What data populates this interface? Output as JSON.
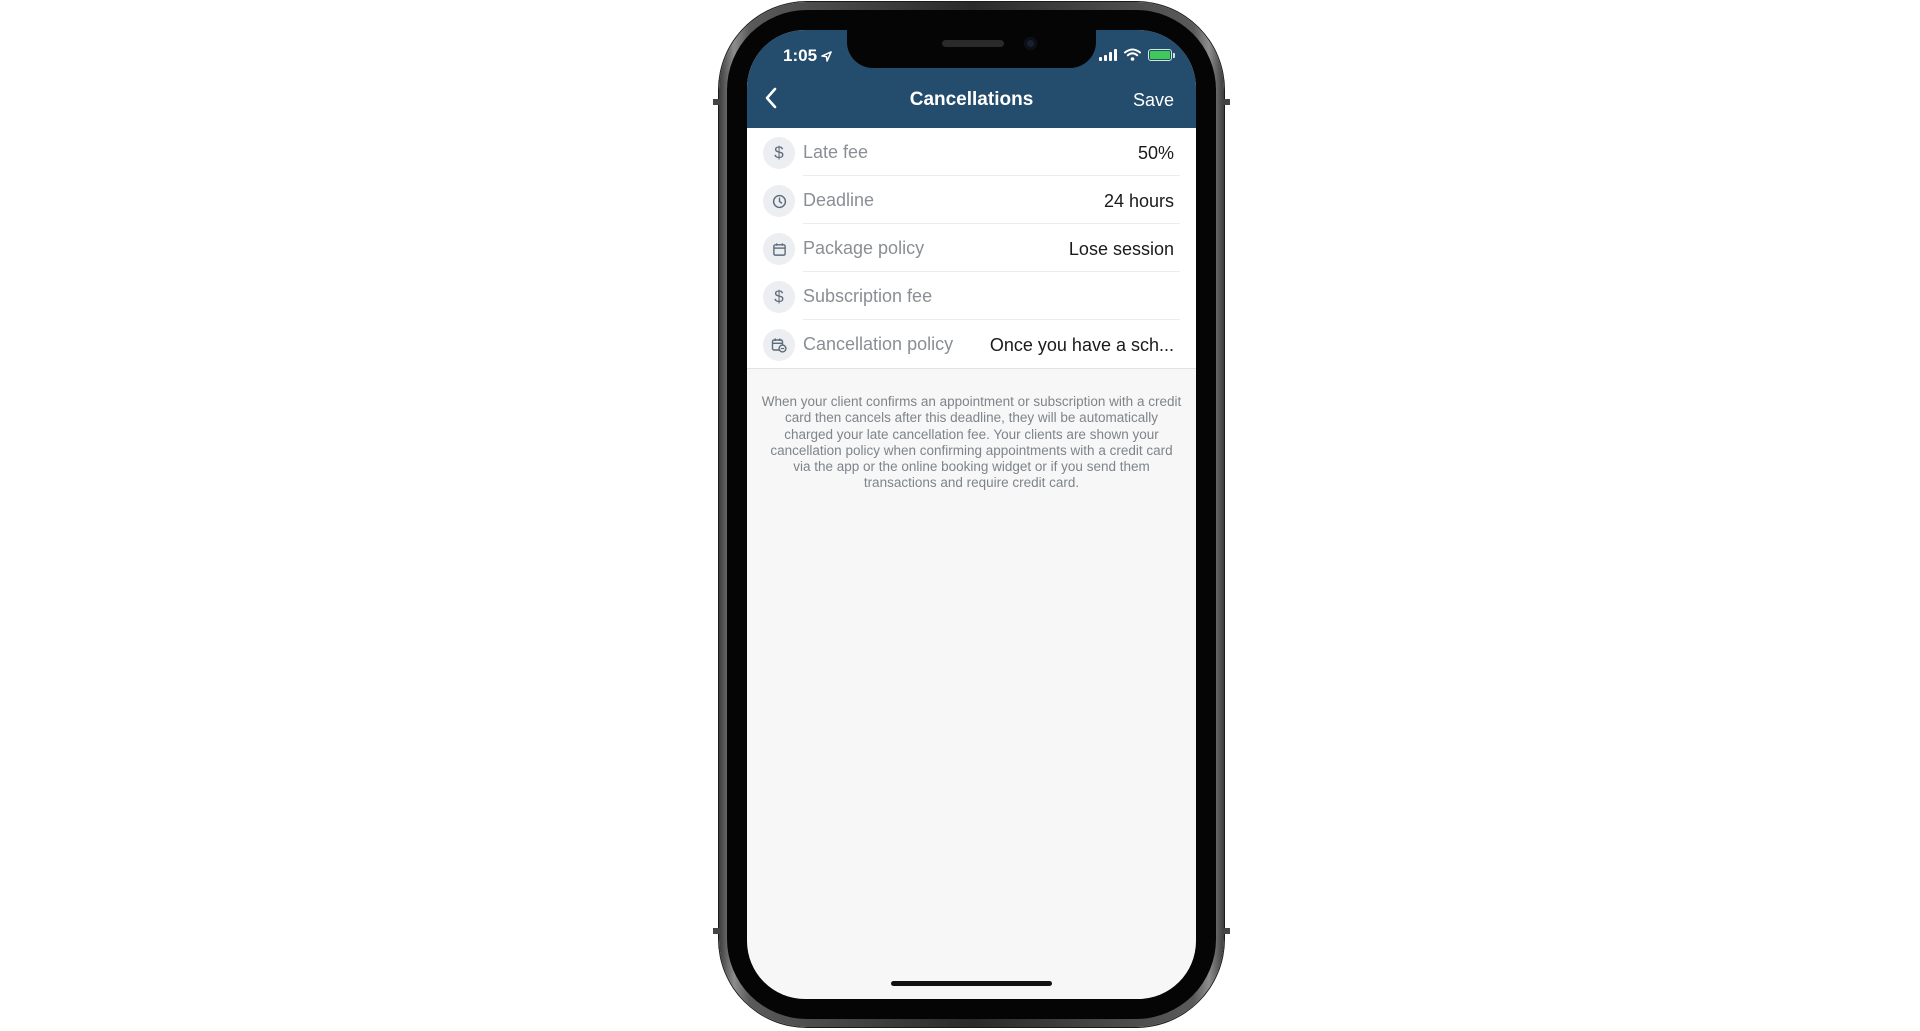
{
  "status_bar": {
    "time": "1:05"
  },
  "nav": {
    "title": "Cancellations",
    "save_label": "Save"
  },
  "rows": [
    {
      "icon": "dollar-icon",
      "glyph": "$",
      "label": "Late fee",
      "value": "50%"
    },
    {
      "icon": "clock-icon",
      "glyph": "",
      "label": "Deadline",
      "value": "24 hours"
    },
    {
      "icon": "calendar-icon",
      "glyph": "",
      "label": "Package policy",
      "value": "Lose session"
    },
    {
      "icon": "dollar-icon",
      "glyph": "$",
      "label": "Subscription fee",
      "value": ""
    },
    {
      "icon": "calendar-policy-icon",
      "glyph": "",
      "label": "Cancellation policy",
      "value": "Once you have a sch..."
    }
  ],
  "note": "When your client confirms an appointment or subscription with a credit card then cancels after this deadline, they will be automatically charged your late cancellation fee. Your clients are shown your cancellation policy when confirming appointments with a credit card via the app or the online booking widget or if you send them transactions and require credit card.",
  "colors": {
    "header": "#244c6c",
    "battery": "#3ec95a",
    "background": "#f7f7f7"
  }
}
